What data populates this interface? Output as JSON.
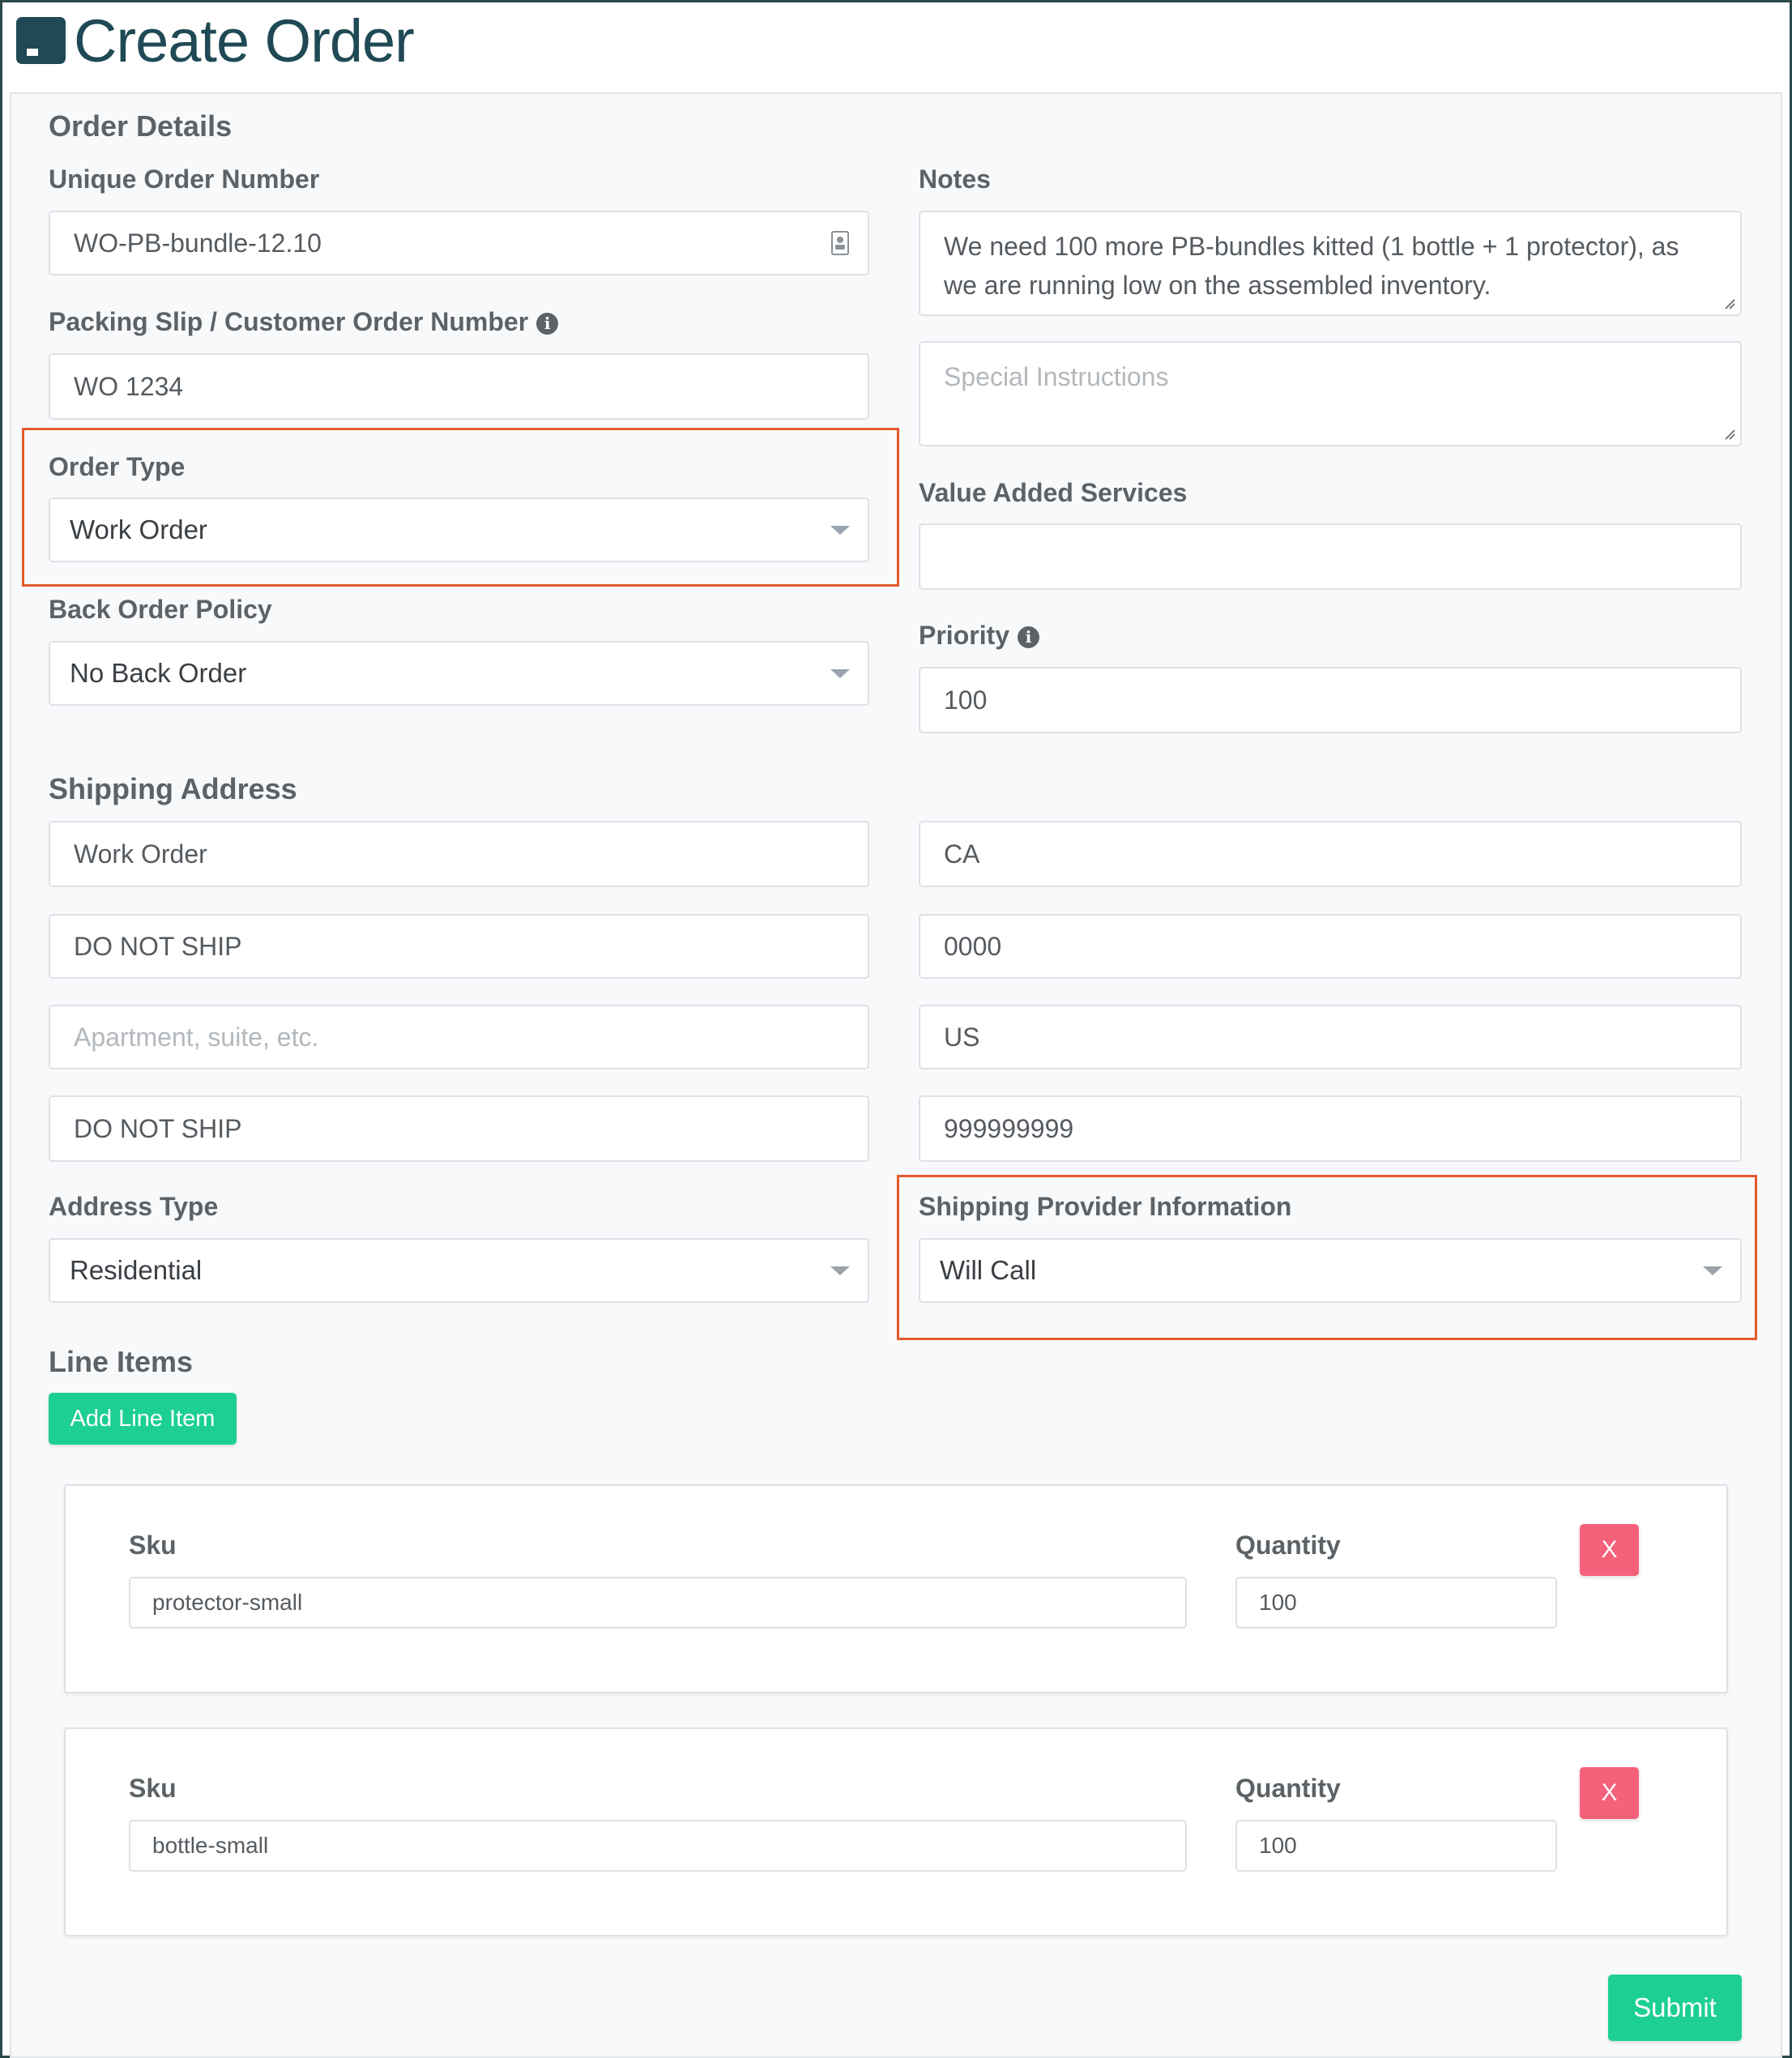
{
  "header": {
    "title": "Create Order",
    "icon": "box-icon"
  },
  "order_details": {
    "section_title": "Order Details",
    "unique_order_number": {
      "label": "Unique Order Number",
      "value": "WO-PB-bundle-12.10"
    },
    "packing_slip": {
      "label": "Packing Slip / Customer Order Number",
      "value": "WO 1234"
    },
    "order_type": {
      "label": "Order Type",
      "value": "Work Order"
    },
    "back_order_policy": {
      "label": "Back Order Policy",
      "value": "No Back Order"
    },
    "notes": {
      "label": "Notes",
      "value": "We need 100 more PB-bundles kitted (1 bottle + 1 protector), as we are running low on the assembled inventory."
    },
    "special_instructions": {
      "placeholder": "Special Instructions"
    },
    "value_added_services": {
      "label": "Value Added Services",
      "value": ""
    },
    "priority": {
      "label": "Priority",
      "value": "100"
    }
  },
  "shipping_address": {
    "section_title": "Shipping Address",
    "name": "Work Order",
    "address1": "DO NOT SHIP",
    "address2_placeholder": "Apartment, suite, etc.",
    "city": "DO NOT SHIP",
    "state": "CA",
    "zip": "0000",
    "country": "US",
    "phone": "999999999",
    "address_type": {
      "label": "Address Type",
      "value": "Residential"
    },
    "shipping_provider": {
      "label": "Shipping Provider Information",
      "value": "Will Call"
    }
  },
  "line_items": {
    "section_title": "Line Items",
    "add_button": "Add Line Item",
    "items": [
      {
        "sku_label": "Sku",
        "sku": "protector-small",
        "qty_label": "Quantity",
        "qty": "100",
        "remove": "X"
      },
      {
        "sku_label": "Sku",
        "sku": "bottle-small",
        "qty_label": "Quantity",
        "qty": "100",
        "remove": "X"
      }
    ]
  },
  "submit_label": "Submit",
  "colors": {
    "accent_green": "#1dcf93",
    "remove_red": "#f5607b",
    "highlight_orange": "#e55a2b",
    "title_teal": "#1f4a55"
  }
}
